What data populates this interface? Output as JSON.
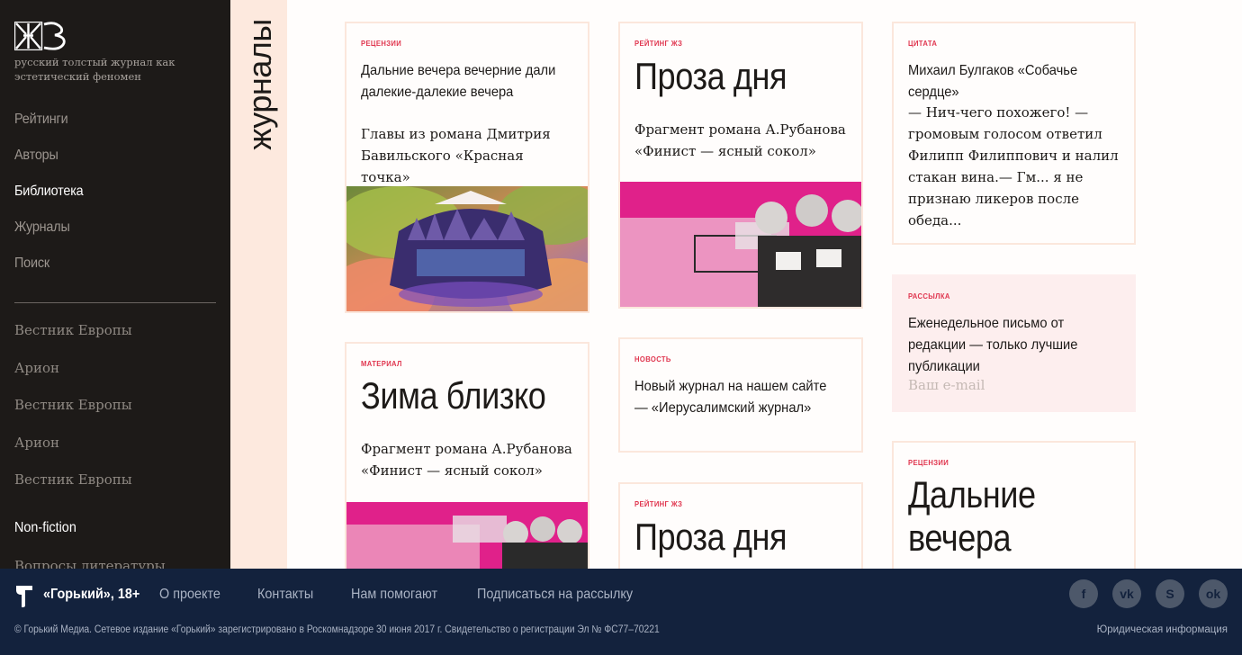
{
  "sidebar": {
    "logo_alt": "ЖЗ",
    "tagline": "русский толстый журнал как эстетический феномен",
    "nav": [
      {
        "label": "Рейтинги",
        "active": false
      },
      {
        "label": "Авторы",
        "active": false
      },
      {
        "label": "Библиотека",
        "active": true
      },
      {
        "label": "Журналы",
        "active": false
      },
      {
        "label": "Поиск",
        "active": false
      }
    ],
    "journals": [
      "Вестник Европы",
      "Арион",
      "Вестник Европы",
      "Арион",
      "Вестник Европы"
    ],
    "nonfiction": "Non-fiction",
    "cut_item": "Вопросы литературы"
  },
  "strip": {
    "label": "журналы"
  },
  "cards": {
    "c1": {
      "tag": "РЕЦЕНЗИИ",
      "title": "Дальние вечера вечерние дали далекие-далекие вечера",
      "text": "Главы из романа Дмитрия Бавильского «Красная точка»"
    },
    "c2": {
      "tag": "МАТЕРИАЛ",
      "title": "Зима близко",
      "text": "Фрагмент романа А.Рубанова «Финист — ясный сокол»"
    },
    "c3": {
      "tag": "РЕЙТИНГ ЖЗ",
      "title": "Проза дня",
      "text": "Фрагмент романа А.Рубанова «Финист — ясный сокол»"
    },
    "c4": {
      "tag": "НОВОСТЬ",
      "title": "Новый журнал на нашем сайте — «Иерусалимский журнал»"
    },
    "c5": {
      "tag": "РЕЙТИНГ ЖЗ",
      "title": "Проза дня"
    },
    "c6": {
      "tag": "ЦИТАТА",
      "title": "Михаил Булгаков «Собачье сердце»",
      "text": "— Нич-чего похожего! — громовым голосом ответил Филипп Филиппович и налил стакан вина.— Гм... я не признаю ликеров после обеда..."
    },
    "c7": {
      "tag": "РАССЫЛКА",
      "title": "Еженедельное письмо от редакции — только лучшие публикации",
      "email_placeholder": "Ваш e-mail"
    },
    "c8": {
      "tag": "РЕЦЕНЗИИ",
      "title": "Дальние вечера"
    }
  },
  "footer": {
    "brand": "«Горький», 18+",
    "links": [
      "О проекте",
      "Контакты",
      "Нам помогают",
      "Подписаться на рассылку"
    ],
    "socials": [
      "facebook-icon",
      "vk-icon",
      "zen-icon",
      "odnoklassniki-icon"
    ],
    "copyright": "© Горький Медиа. Сетевое издание «Горький» зарегистрировано в Роскомнадзоре 30 июня 2017 г. Свидетельство о регистрации Эл № ФС77–70221",
    "legal": "Юридическая информация"
  },
  "colors": {
    "accent": "#e0364f",
    "sidebar": "#1d1a18",
    "footer": "#13223d",
    "strip": "#fde9de"
  }
}
